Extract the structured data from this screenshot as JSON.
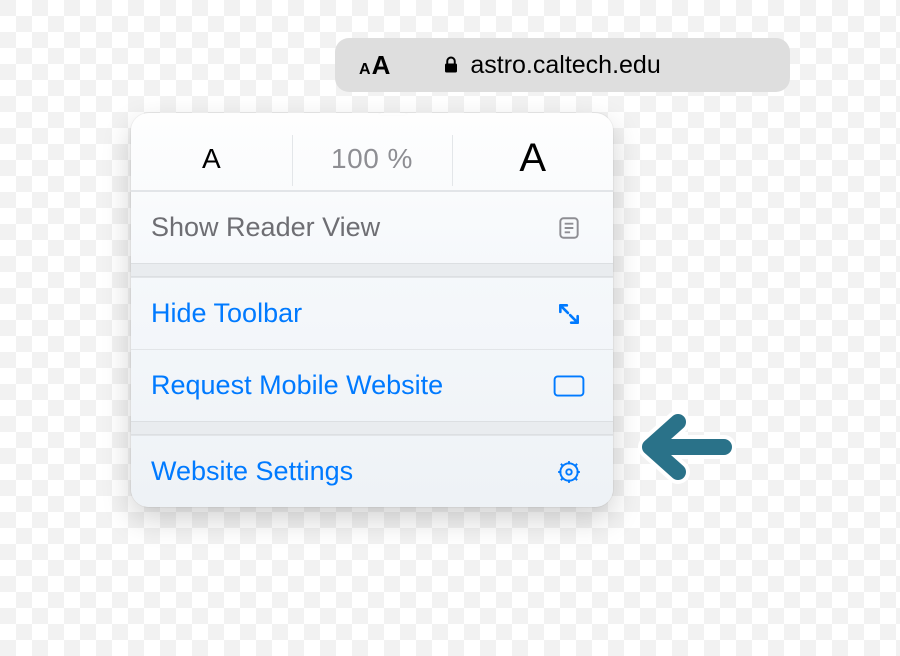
{
  "urlbar": {
    "domain": "astro.caltech.edu"
  },
  "popover": {
    "zoom": {
      "percent": "100 %",
      "smaller_glyph": "A",
      "larger_glyph": "A"
    },
    "reader_label": "Show Reader View",
    "hide_toolbar_label": "Hide Toolbar",
    "request_mobile_label": "Request Mobile Website",
    "website_settings_label": "Website Settings"
  }
}
